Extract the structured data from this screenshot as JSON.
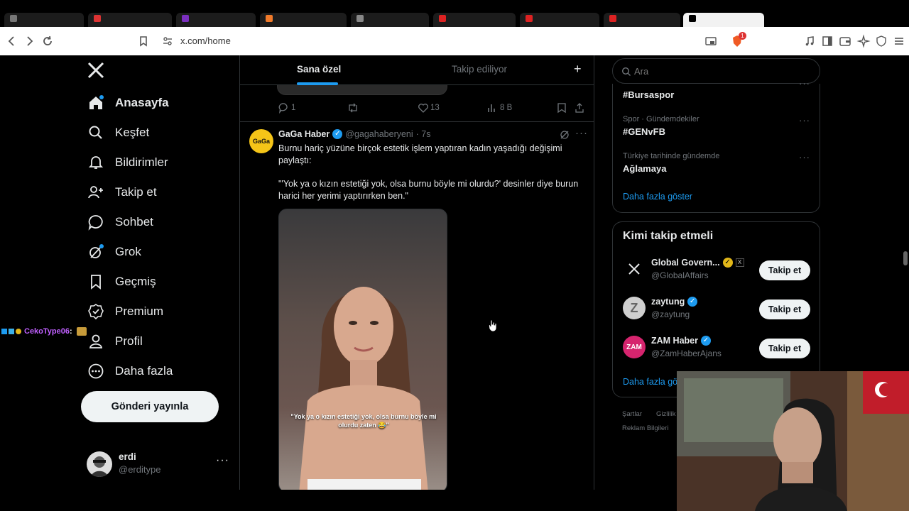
{
  "browser": {
    "url": "x.com/home",
    "shield_badge": "1"
  },
  "sidebar": {
    "items": [
      {
        "label": "Anasayfa",
        "icon": "home-icon"
      },
      {
        "label": "Keşfet",
        "icon": "search-icon"
      },
      {
        "label": "Bildirimler",
        "icon": "bell-icon"
      },
      {
        "label": "Takip et",
        "icon": "add-user-icon"
      },
      {
        "label": "Sohbet",
        "icon": "chat-icon"
      },
      {
        "label": "Grok",
        "icon": "grok-icon"
      },
      {
        "label": "Geçmiş",
        "icon": "bookmark-icon"
      },
      {
        "label": "Premium",
        "icon": "premium-icon"
      },
      {
        "label": "Profil",
        "icon": "profile-icon"
      },
      {
        "label": "Daha fazla",
        "icon": "more-circle-icon"
      }
    ],
    "post_button": "Gönderi yayınla",
    "account": {
      "name": "erdi",
      "handle": "@erditype"
    }
  },
  "feed": {
    "tabs": [
      "Sana özel",
      "Takip ediliyor"
    ],
    "prev_tweet_actions": {
      "replies": "1",
      "likes": "13",
      "views": "8 B"
    },
    "tweet": {
      "author": "GaGa Haber",
      "handle": "@gagahaberyeni",
      "time": "· 7s",
      "avatar_text": "GaGa",
      "text1": "Burnu hariç yüzüne birçok estetik işlem yaptıran kadın yaşadığı değişimi paylaştı:",
      "text2": "\"'Yok ya o kızın estetiği yok, olsa burnu böyle mi olurdu?' desinler diye burun harici her yerimi yaptırırken ben.\"",
      "video_caption": "\"Yok ya o kızın estetiği yok, olsa burnu böyle mi olurdu zaten 😂\""
    }
  },
  "chat_overlay": {
    "user": "CekoType06",
    "suffix": " :"
  },
  "rightcol": {
    "search_placeholder": "Ara",
    "trends": [
      {
        "context": "",
        "name": "#Bursaspor"
      },
      {
        "context": "Spor · Gündemdekiler",
        "name": "#GENvFB"
      },
      {
        "context": "Türkiye tarihinde gündemde",
        "name": "Ağlamaya"
      }
    ],
    "trends_more": "Daha fazla göster",
    "who_to_follow": {
      "title": "Kimi takip etmeli",
      "accounts": [
        {
          "name": "Global Govern...",
          "handle": "@GlobalAffairs",
          "button": "Takip et"
        },
        {
          "name": "zaytung",
          "handle": "@zaytung",
          "button": "Takip et"
        },
        {
          "name": "ZAM Haber",
          "handle": "@ZamHaberAjans",
          "button": "Takip et"
        }
      ],
      "more": "Daha fazla göster"
    },
    "footer": [
      "Şartlar",
      "Gizlilik",
      "Reklam Bilgileri"
    ]
  },
  "colors": {
    "accent": "#1d9bf0",
    "background": "#000000",
    "border": "#2f3336",
    "gold": "#e2b719",
    "zam": "#d6246e"
  }
}
